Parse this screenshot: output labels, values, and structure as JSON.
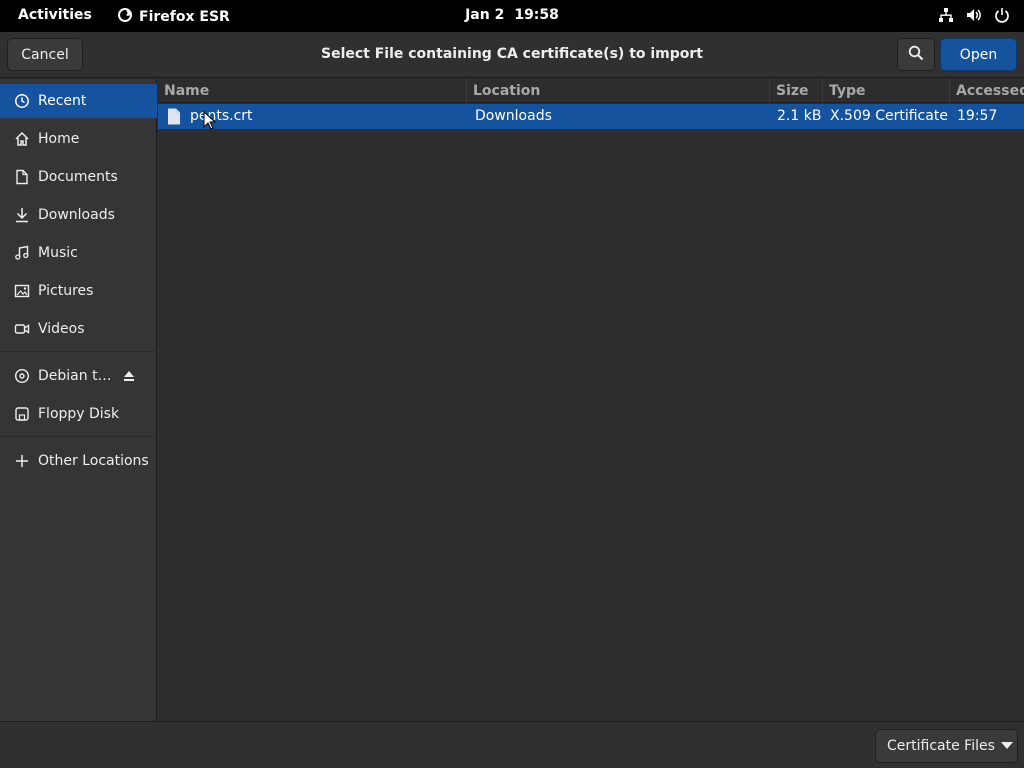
{
  "topbar": {
    "activities": "Activities",
    "app_name": "Firefox ESR",
    "date": "Jan 2",
    "time": "19:58",
    "icons": [
      "network-icon",
      "volume-icon",
      "power-icon"
    ]
  },
  "dialog": {
    "title": "Select File containing CA certificate(s) to import",
    "cancel_label": "Cancel",
    "open_label": "Open",
    "search_icon": "search-icon"
  },
  "sidebar": {
    "items": [
      {
        "label": "Recent",
        "icon": "clock-icon",
        "selected": true
      },
      {
        "label": "Home",
        "icon": "home-icon"
      },
      {
        "label": "Documents",
        "icon": "document-icon"
      },
      {
        "label": "Downloads",
        "icon": "download-icon"
      },
      {
        "label": "Music",
        "icon": "music-icon"
      },
      {
        "label": "Pictures",
        "icon": "pictures-icon"
      },
      {
        "label": "Videos",
        "icon": "video-icon"
      },
      {
        "label": "Debian t…",
        "icon": "disc-icon",
        "eject": true
      },
      {
        "label": "Floppy Disk",
        "icon": "floppy-icon"
      },
      {
        "label": "Other Locations",
        "icon": "plus-icon"
      }
    ]
  },
  "filelist": {
    "columns": [
      "Name",
      "Location",
      "Size",
      "Type",
      "Accessed"
    ],
    "rows": [
      {
        "name": "pents.crt",
        "location": "Downloads",
        "size": "2.1 kB",
        "type": "X.509 Certificate",
        "accessed": "19:57",
        "selected": true
      }
    ]
  },
  "footer": {
    "filter_label": "Certificate Files"
  },
  "colors": {
    "accent": "#15539e",
    "background": "#2d2d2d",
    "sidebar": "#353535",
    "topbar": "#000000"
  }
}
